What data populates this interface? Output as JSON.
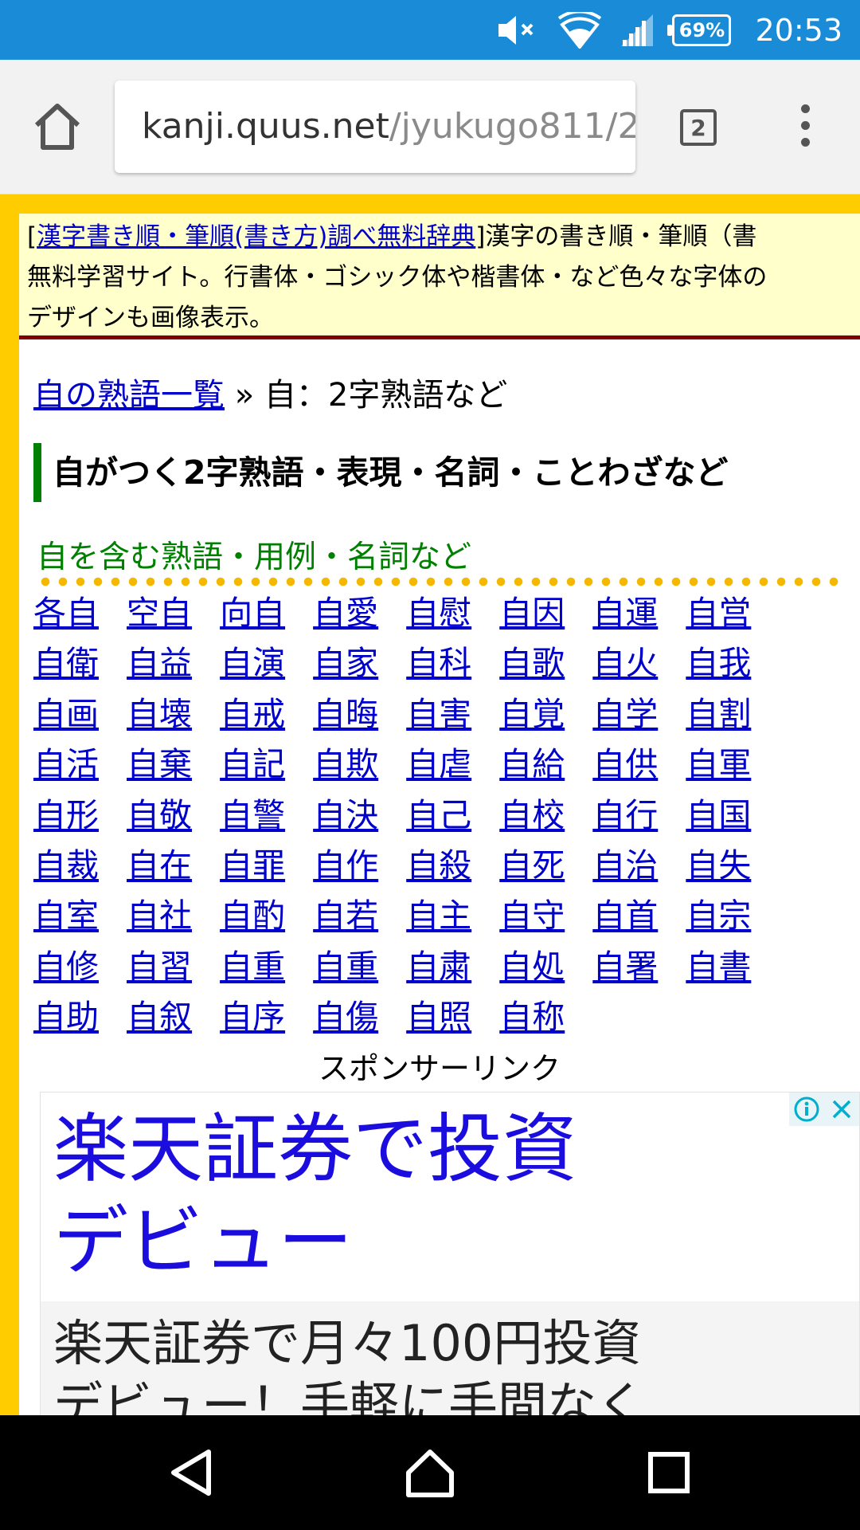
{
  "status_bar": {
    "battery": "69%",
    "time": "20:53",
    "icons": [
      "mute-icon",
      "wifi-icon",
      "signal-icon",
      "battery-icon"
    ]
  },
  "browser": {
    "url_host": "kanji.quus.net",
    "url_path": "/jyukugo811/2",
    "tab_count": "2"
  },
  "site_desc": {
    "link_text": "漢字書き順・筆順(書き方)調べ無料辞典",
    "line1_text": "漢字の書き順・筆順（書",
    "line2": "無料学習サイト。行書体・ゴシック体や楷書体・など色々な字体の",
    "line3": "デザインも画像表示。"
  },
  "breadcrumb": {
    "link": "自の熟語一覧",
    "separator": "»",
    "current": "自：2字熟語など"
  },
  "heading": "自がつく2字熟語・表現・名詞・ことわざなど",
  "subheading": "自を含む熟語・用例・名詞など",
  "words": [
    "各自",
    "空自",
    "向自",
    "自愛",
    "自慰",
    "自因",
    "自運",
    "自営",
    "自衛",
    "自益",
    "自演",
    "自家",
    "自科",
    "自歌",
    "自火",
    "自我",
    "自画",
    "自壊",
    "自戒",
    "自晦",
    "自害",
    "自覚",
    "自学",
    "自割",
    "自活",
    "自棄",
    "自記",
    "自欺",
    "自虐",
    "自給",
    "自供",
    "自軍",
    "自形",
    "自敬",
    "自警",
    "自決",
    "自己",
    "自校",
    "自行",
    "自国",
    "自裁",
    "自在",
    "自罪",
    "自作",
    "自殺",
    "自死",
    "自治",
    "自失",
    "自室",
    "自社",
    "自酌",
    "自若",
    "自主",
    "自守",
    "自首",
    "自宗",
    "自修",
    "自習",
    "自重",
    "自重",
    "自粛",
    "自処",
    "自署",
    "自書",
    "自助",
    "自叙",
    "自序",
    "自傷",
    "自照",
    "自称"
  ],
  "sponsor_label": "スポンサーリンク",
  "ad": {
    "title_line1": "楽天証券で投資",
    "title_line2": "デビュー",
    "body_line1": "楽天証券で月々100円投資",
    "body_line2": "デビュー！手軽に手間なく"
  },
  "colors": {
    "status_bar": "#1a8bd6",
    "page_border": "#ffcc00",
    "link": "#0000cc",
    "heading_accent": "#008000",
    "subheading": "#008000",
    "desc_bg": "#ffffcc",
    "desc_border": "#800000",
    "ad_title": "#1a0dde"
  }
}
